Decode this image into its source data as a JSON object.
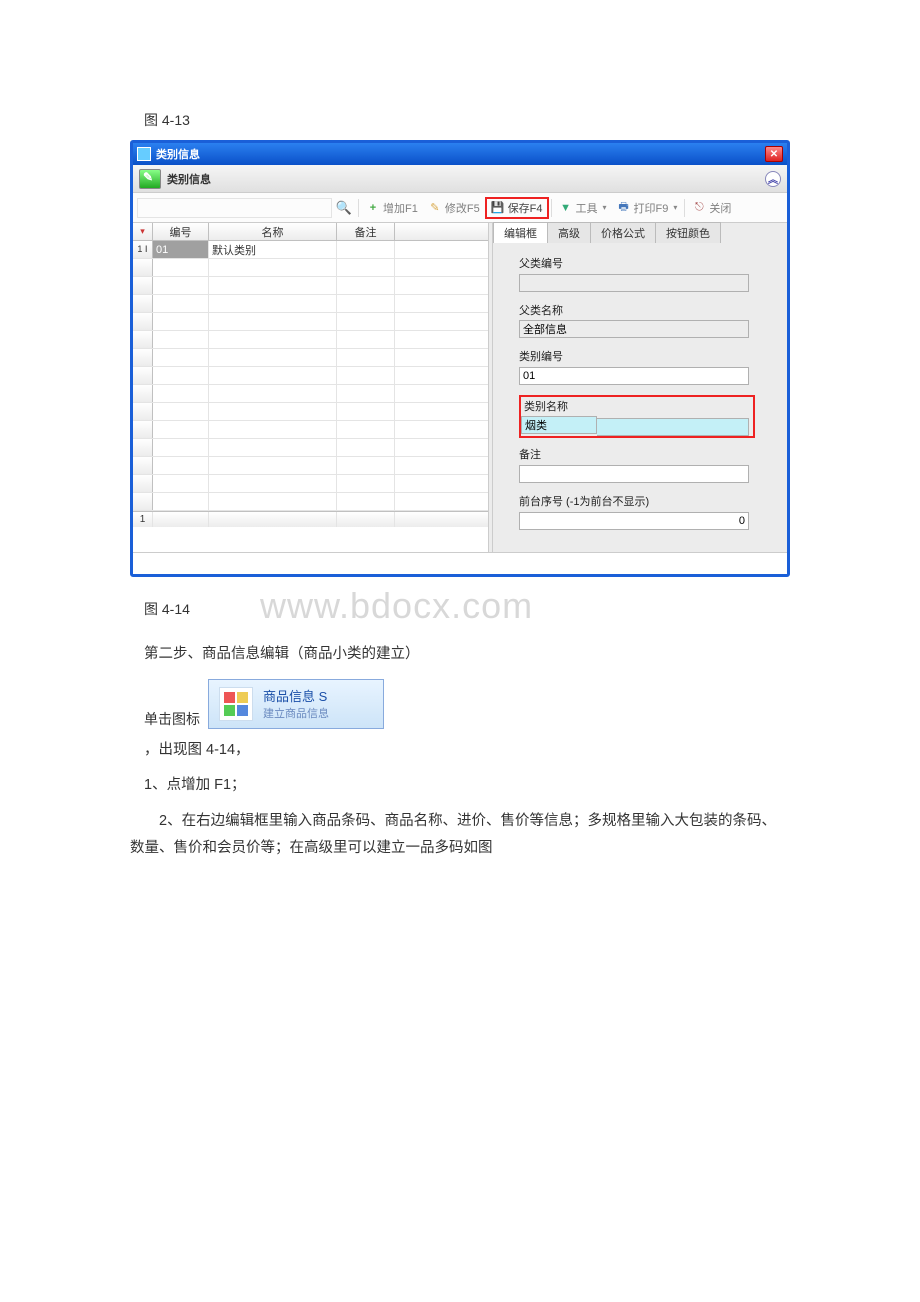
{
  "captions": {
    "fig413": "图 4-13",
    "fig414": "图 4-14"
  },
  "watermark": "www.bdocx.com",
  "window": {
    "title": "类别信息",
    "sub_title": "类别信息",
    "collapse_glyph": "︽",
    "close_glyph": "✕",
    "toolbar": {
      "add": "增加F1",
      "edit": "修改F5",
      "save": "保存F4",
      "tool": "工具",
      "print": "打印F9",
      "close": "关闭",
      "search_glyph": "🔍",
      "add_glyph": "+",
      "edit_glyph": "✎",
      "save_glyph": "💾",
      "funnel_glyph": "▼",
      "print_glyph": "🖶",
      "close_glyph": "⎋",
      "drop_glyph": "▾"
    },
    "grid": {
      "headers": {
        "code": "编号",
        "name": "名称",
        "note": "备注"
      },
      "row1": {
        "marker": "1 Ⅰ",
        "code": "01",
        "name": "默认类别",
        "note": ""
      },
      "footer_marker": "1"
    },
    "tabs": {
      "edit": "编辑框",
      "adv": "高级",
      "price": "价格公式",
      "btncolor": "按钮颜色"
    },
    "form": {
      "parent_code_label": "父类编号",
      "parent_code_value": "",
      "parent_name_label": "父类名称",
      "parent_name_value": "全部信息",
      "cat_code_label": "类别编号",
      "cat_code_value": "01",
      "cat_name_label": "类别名称",
      "cat_name_value": "烟类",
      "note_label": "备注",
      "note_value": "",
      "seq_label": "前台序号 (-1为前台不显示)",
      "seq_value": "0"
    }
  },
  "body_text": {
    "step2": "第二步、商品信息编辑（商品小类的建立）",
    "click_icon_prefix": "单击图标",
    "appear": "，出现图 4-14，",
    "item1": "1、点增加 F1；",
    "item2": "2、在右边编辑框里输入商品条码、商品名称、进价、售价等信息；多规格里输入大包装的条码、数量、售价和会员价等；在高级里可以建立一品多码如图"
  },
  "inline_button": {
    "title": "商品信息 S",
    "subtitle": "建立商品信息"
  }
}
